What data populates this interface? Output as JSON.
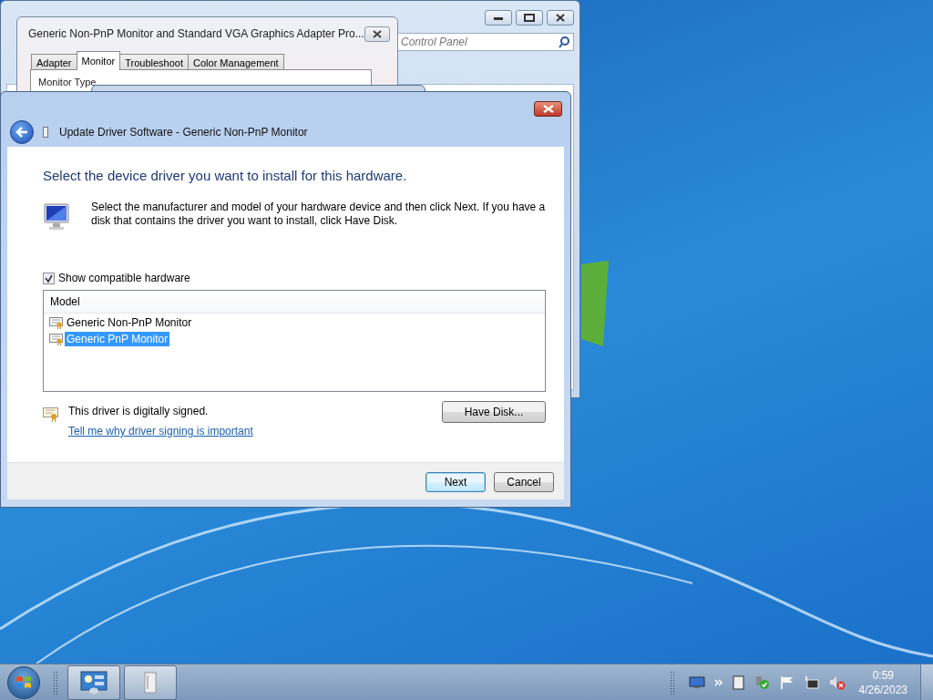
{
  "background_window": {
    "search": {
      "placeholder": "Control Panel"
    }
  },
  "properties_dialog": {
    "title": "Generic Non-PnP Monitor and Standard VGA Graphics Adapter Pro...",
    "tabs": [
      {
        "label": "Adapter",
        "selected": false
      },
      {
        "label": "Monitor",
        "selected": true
      },
      {
        "label": "Troubleshoot",
        "selected": false
      },
      {
        "label": "Color Management",
        "selected": false
      }
    ],
    "group_label": "Monitor Type"
  },
  "wizard": {
    "title": "Update Driver Software - Generic Non-PnP Monitor",
    "heading": "Select the device driver you want to install for this hardware.",
    "description": "Select the manufacturer and model of your hardware device and then click Next. If you have a disk that contains the driver you want to install, click Have Disk.",
    "show_compatible": {
      "label": "Show compatible hardware",
      "checked": true
    },
    "list": {
      "column": "Model",
      "items": [
        {
          "label": "Generic Non-PnP Monitor",
          "selected": false
        },
        {
          "label": "Generic PnP Monitor",
          "selected": true
        }
      ]
    },
    "signed_text": "This driver is digitally signed.",
    "link": "Tell me why driver signing is important",
    "have_disk": "Have Disk...",
    "buttons": [
      {
        "label": "Next",
        "kind": "default"
      },
      {
        "label": "Cancel",
        "kind": "normal"
      }
    ]
  },
  "taskbar": {
    "clock": {
      "time": "0:59",
      "date": "4/26/2023"
    }
  }
}
